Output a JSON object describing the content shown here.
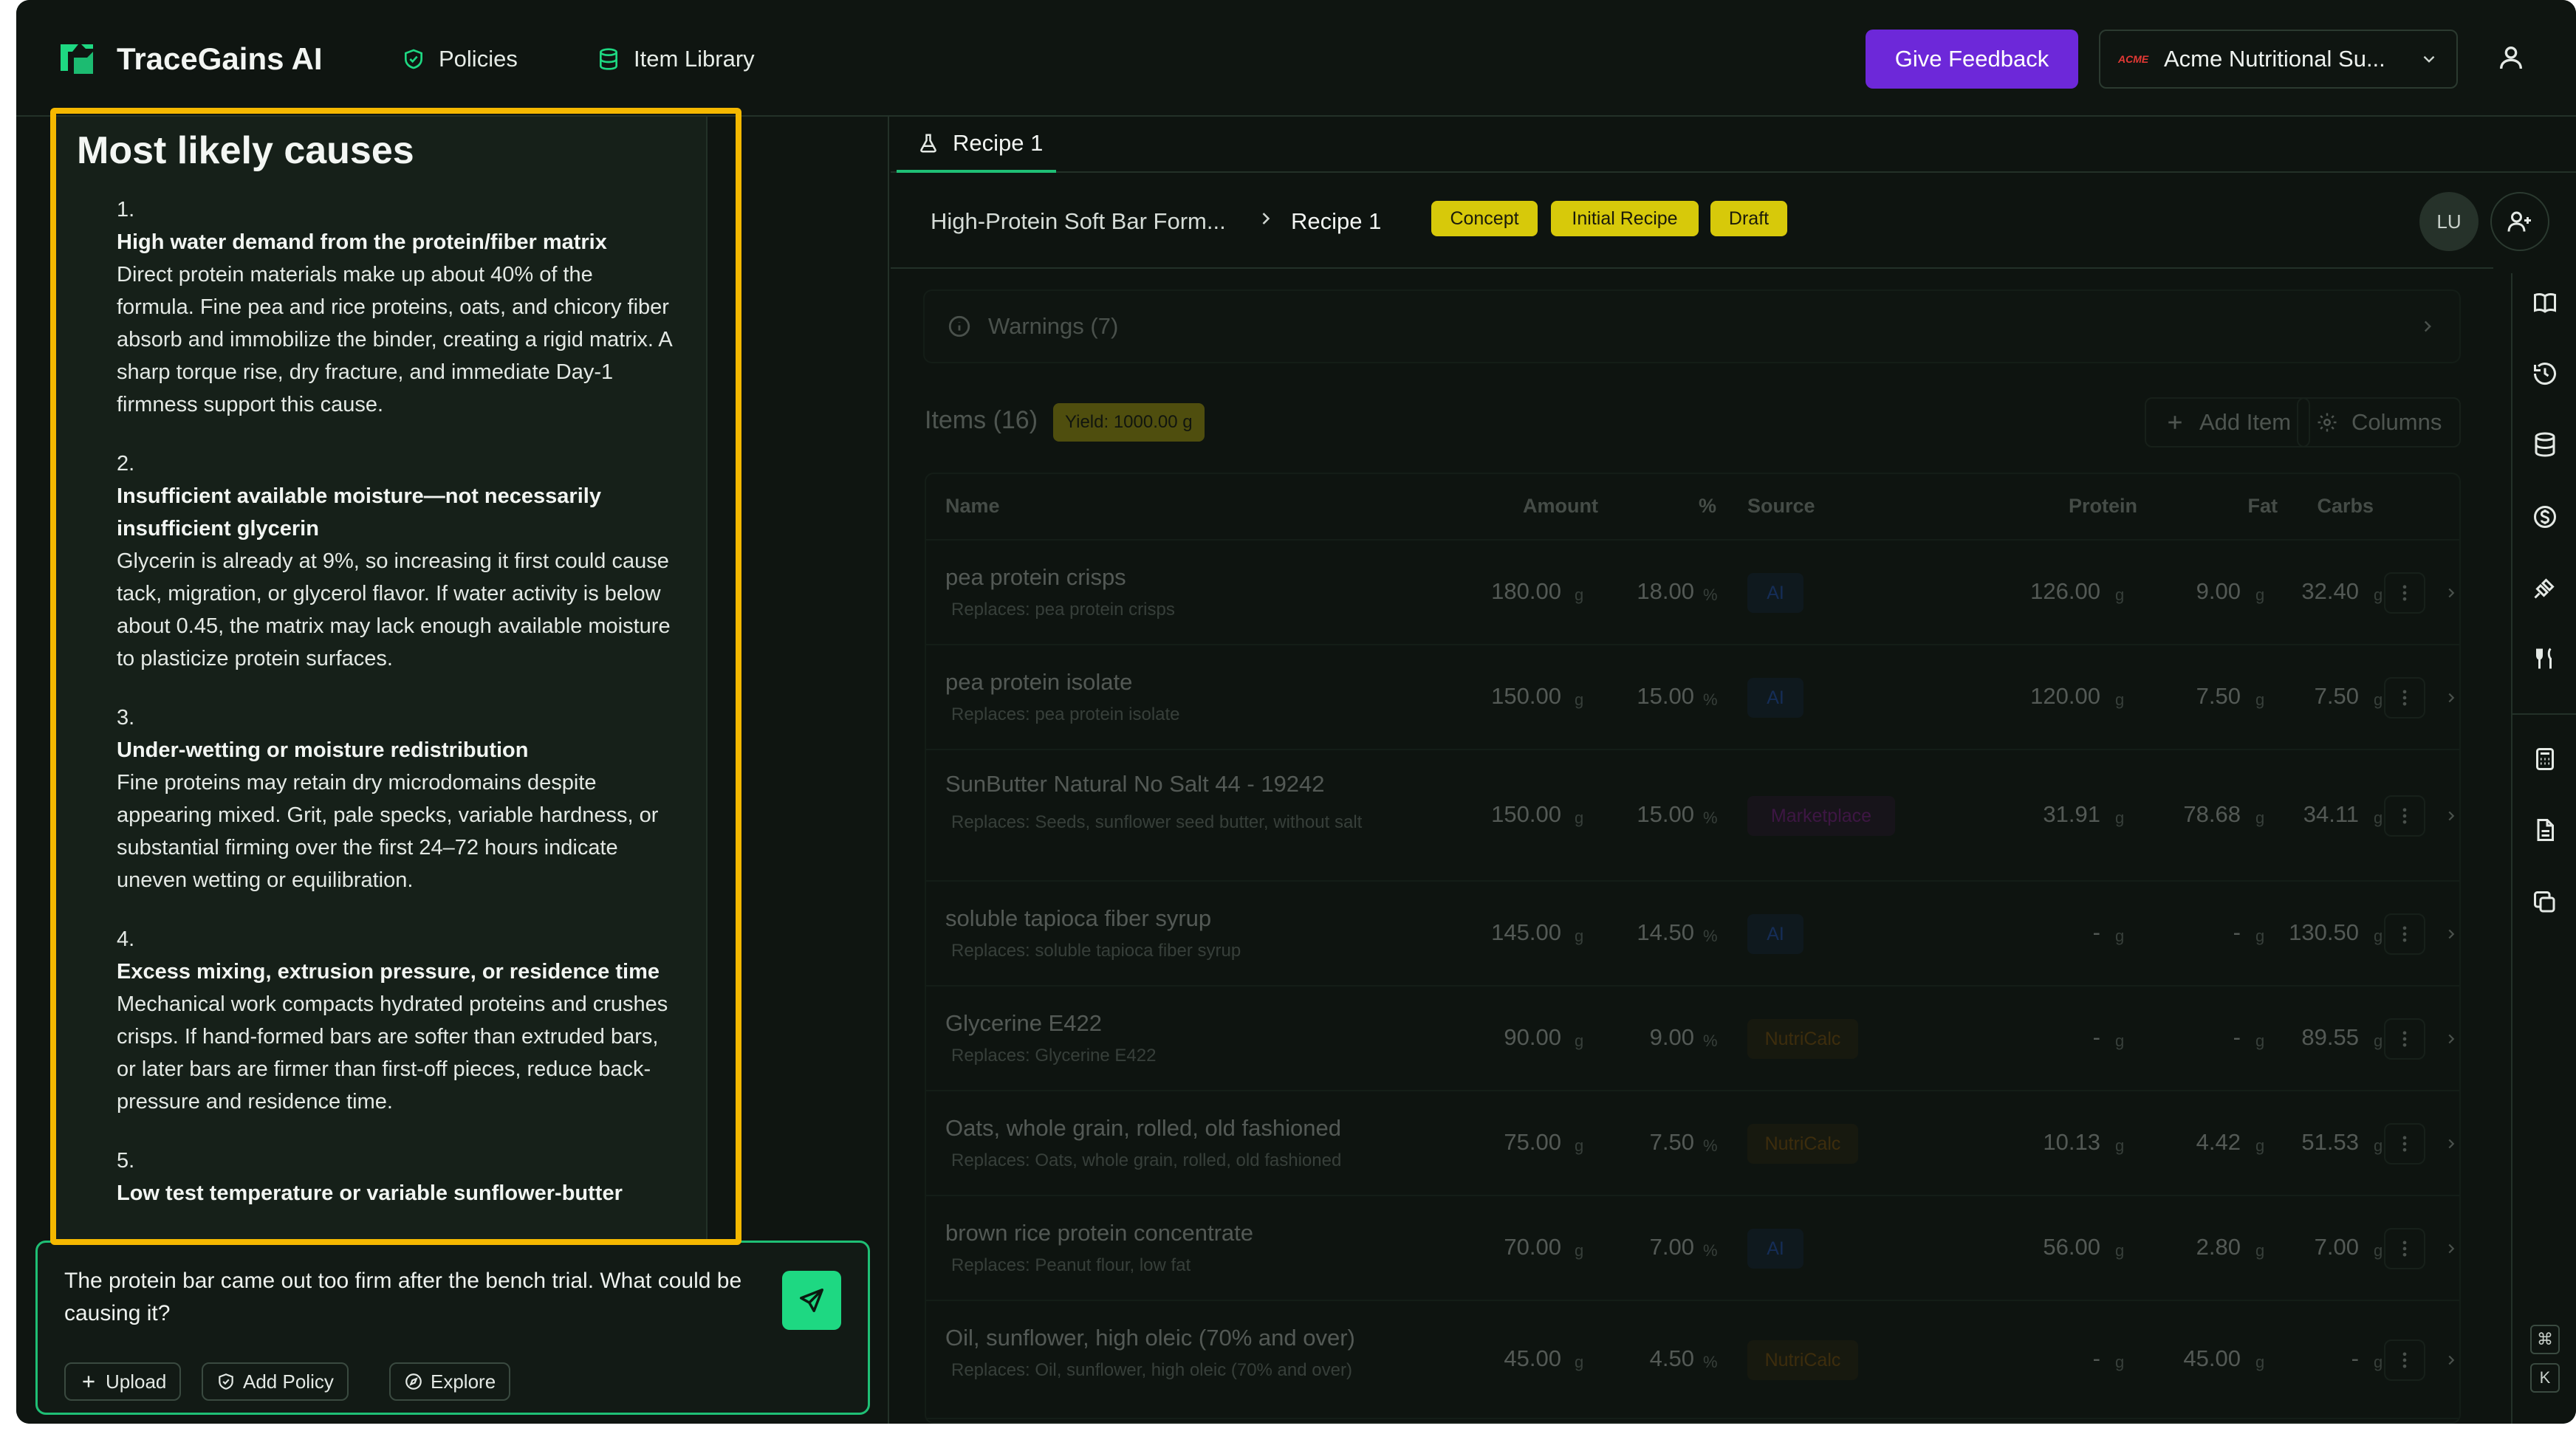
{
  "nav": {
    "brand": "TraceGains AI",
    "policies_label": "Policies",
    "item_library_label": "Item Library",
    "feedback_label": "Give Feedback",
    "org_logo_text": "ACME",
    "org_name": "Acme Nutritional Su..."
  },
  "chat": {
    "heading": "Most likely causes",
    "causes": [
      {
        "num": "1.",
        "title": "High water demand from the protein/fiber matrix",
        "body": "Direct protein materials make up about 40% of the formula. Fine pea and rice proteins, oats, and chicory fiber absorb and immobilize the binder, creating a rigid matrix. A sharp torque rise, dry fracture, and immediate Day-1 firmness support this cause."
      },
      {
        "num": "2.",
        "title": "Insufficient available moisture—not necessarily insufficient glycerin",
        "body": "Glycerin is already at 9%, so increasing it first could cause tack, migration, or glycerol flavor. If water activity is below about 0.45, the matrix may lack enough available moisture to plasticize protein surfaces."
      },
      {
        "num": "3.",
        "title": "Under-wetting or moisture redistribution",
        "body": "Fine proteins may retain dry microdomains despite appearing mixed. Grit, pale specks, variable hardness, or substantial firming over the first 24–72 hours indicate uneven wetting or equilibration."
      },
      {
        "num": "4.",
        "title": "Excess mixing, extrusion pressure, or residence time",
        "body": "Mechanical work compacts hydrated proteins and crushes crisps. If hand-formed bars are softer than extruded bars, or later bars are firmer than first-off pieces, reduce back-pressure and residence time."
      },
      {
        "num": "5.",
        "title": "Low test temperature or variable sunflower-butter",
        "body": ""
      }
    ],
    "input_text": "The protein bar came out too firm after the bench trial. What could be causing it?",
    "upload_label": "Upload",
    "add_policy_label": "Add Policy",
    "explore_label": "Explore"
  },
  "recipe": {
    "tab_label": "Recipe 1",
    "breadcrumb_parent": "High-Protein Soft Bar Form...",
    "breadcrumb_current": "Recipe 1",
    "badges": [
      "Concept",
      "Initial Recipe",
      "Draft"
    ],
    "avatar_initials": "LU",
    "warnings_label": "Warnings (7)",
    "items_title": "Items (16)",
    "yield_label": "Yield: 1000.00 g",
    "add_item_label": "Add Item",
    "columns_label": "Columns",
    "columns": [
      "Name",
      "Amount",
      "%",
      "Source",
      "Protein",
      "Fat",
      "Carbs"
    ],
    "rows": [
      {
        "name": "pea protein crisps",
        "replaces": "Replaces: pea protein crisps",
        "amount": "180.00",
        "amount_unit": "g",
        "pct": "18.00",
        "pct_unit": "%",
        "source": "AI",
        "protein": "126.00",
        "fat": "9.00",
        "carbs": "32.40",
        "unit": "g"
      },
      {
        "name": "pea protein isolate",
        "replaces": "Replaces: pea protein isolate",
        "amount": "150.00",
        "amount_unit": "g",
        "pct": "15.00",
        "pct_unit": "%",
        "source": "AI",
        "protein": "120.00",
        "fat": "7.50",
        "carbs": "7.50",
        "unit": "g"
      },
      {
        "name": "SunButter Natural No Salt 44 - 19242",
        "replaces": "Replaces: Seeds, sunflower seed butter, without salt",
        "amount": "150.00",
        "amount_unit": "g",
        "pct": "15.00",
        "pct_unit": "%",
        "source": "Marketplace",
        "protein": "31.91",
        "fat": "78.68",
        "carbs": "34.11",
        "unit": "g"
      },
      {
        "name": "soluble tapioca fiber syrup",
        "replaces": "Replaces: soluble tapioca fiber syrup",
        "amount": "145.00",
        "amount_unit": "g",
        "pct": "14.50",
        "pct_unit": "%",
        "source": "AI",
        "protein": "-",
        "fat": "-",
        "carbs": "130.50",
        "unit": "g"
      },
      {
        "name": "Glycerine E422",
        "replaces": "Replaces: Glycerine E422",
        "amount": "90.00",
        "amount_unit": "g",
        "pct": "9.00",
        "pct_unit": "%",
        "source": "NutriCalc",
        "protein": "-",
        "fat": "-",
        "carbs": "89.55",
        "unit": "g"
      },
      {
        "name": "Oats, whole grain, rolled, old fashioned",
        "replaces": "Replaces: Oats, whole grain, rolled, old fashioned",
        "amount": "75.00",
        "amount_unit": "g",
        "pct": "7.50",
        "pct_unit": "%",
        "source": "NutriCalc",
        "protein": "10.13",
        "fat": "4.42",
        "carbs": "51.53",
        "unit": "g"
      },
      {
        "name": "brown rice protein concentrate",
        "replaces": "Replaces: Peanut flour, low fat",
        "amount": "70.00",
        "amount_unit": "g",
        "pct": "7.00",
        "pct_unit": "%",
        "source": "AI",
        "protein": "56.00",
        "fat": "2.80",
        "carbs": "7.00",
        "unit": "g"
      },
      {
        "name": "Oil, sunflower, high oleic (70% and over)",
        "replaces": "Replaces: Oil, sunflower, high oleic (70% and over)",
        "amount": "45.00",
        "amount_unit": "g",
        "pct": "4.50",
        "pct_unit": "%",
        "source": "NutriCalc",
        "protein": "-",
        "fat": "45.00",
        "carbs": "-",
        "unit": "g"
      }
    ]
  },
  "shortcut": {
    "key1": "⌘",
    "key2": "K"
  },
  "colors": {
    "accent_green": "#1ed882",
    "feedback_purple": "#6d28d9",
    "badge_yellow": "#d7c90a",
    "highlight_yellow": "#f5b800",
    "source_ai": "#2563eb",
    "source_marketplace": "#a21caf",
    "source_nutricalc": "#a16207"
  },
  "icons": [
    "tracegains-logo-icon",
    "shield-check-icon",
    "database-icon",
    "chevron-down-icon",
    "user-icon",
    "flask-icon",
    "user-plus-icon",
    "info-icon",
    "plus-icon",
    "gear-icon",
    "send-icon",
    "book-icon",
    "history-icon",
    "dollar-icon",
    "satellite-icon",
    "utensils-icon",
    "calculator-icon",
    "document-icon",
    "copy-icon",
    "kebab-icon",
    "chevron-right-icon"
  ]
}
